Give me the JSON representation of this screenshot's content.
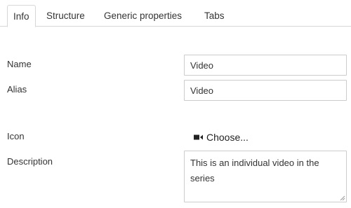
{
  "tabs": [
    {
      "label": "Info",
      "active": true
    },
    {
      "label": "Structure",
      "active": false
    },
    {
      "label": "Generic properties",
      "active": false
    },
    {
      "label": "Tabs",
      "active": false
    }
  ],
  "form": {
    "name": {
      "label": "Name",
      "value": "Video"
    },
    "alias": {
      "label": "Alias",
      "value": "Video"
    },
    "icon": {
      "label": "Icon",
      "icon_name": "video-camera-icon",
      "choose_label": "Choose..."
    },
    "description": {
      "label": "Description",
      "value": "This is an individual video in the series"
    }
  },
  "colors": {
    "border": "#cccccc",
    "tab_border": "#d7d7d7",
    "text": "#333333"
  }
}
